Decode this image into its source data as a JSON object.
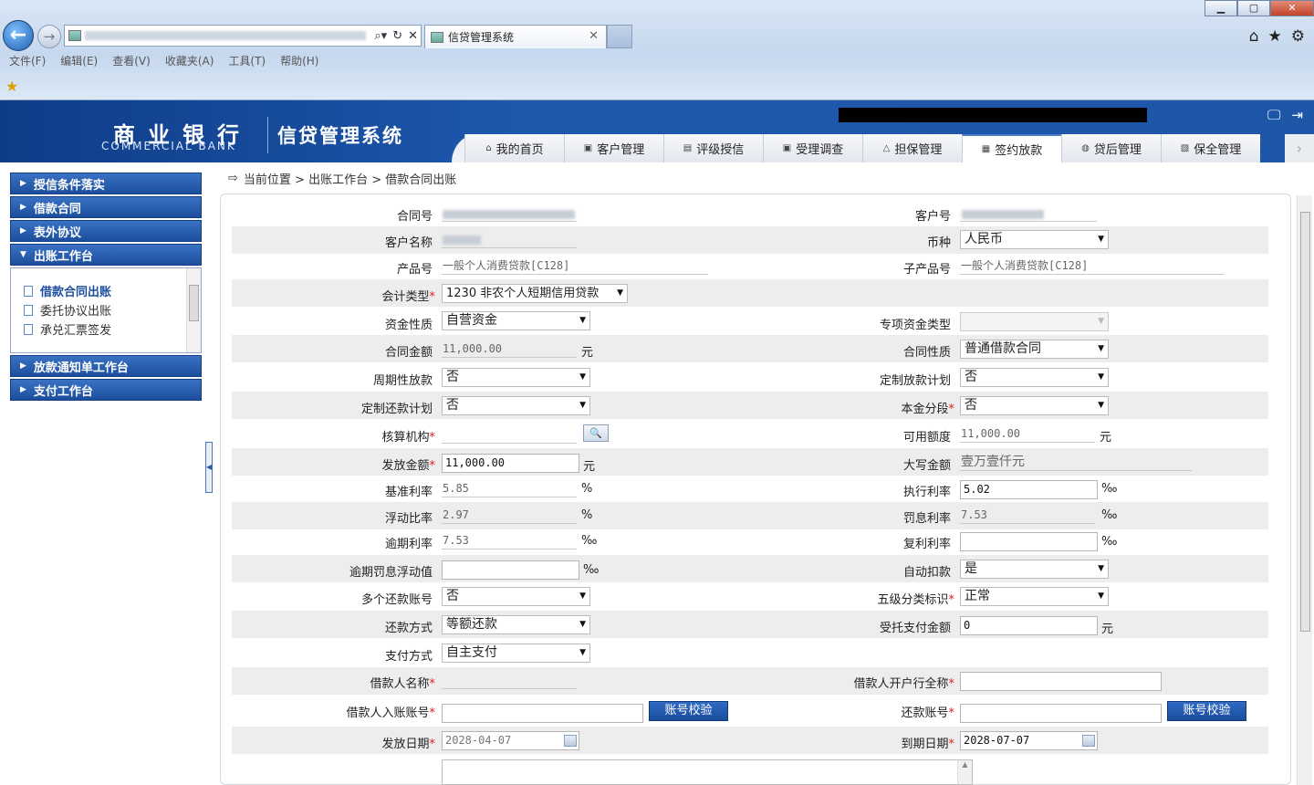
{
  "browser": {
    "tab_title": "信贷管理系统",
    "menu": [
      "文件(F)",
      "编辑(E)",
      "查看(V)",
      "收藏夹(A)",
      "工具(T)",
      "帮助(H)"
    ],
    "window_controls": [
      "▁",
      "▢",
      "✕"
    ]
  },
  "app": {
    "bank_cn": "商业银行",
    "bank_en": "COMMERCIAL BANK",
    "system_name": "信贷管理系统",
    "nav_tabs": [
      {
        "label": "我的首页",
        "icon": "home-icon"
      },
      {
        "label": "客户管理",
        "icon": "customer-icon"
      },
      {
        "label": "评级授信",
        "icon": "rating-icon"
      },
      {
        "label": "受理调查",
        "icon": "survey-icon"
      },
      {
        "label": "担保管理",
        "icon": "guarantee-icon"
      },
      {
        "label": "签约放款",
        "icon": "contract-icon",
        "active": true
      },
      {
        "label": "贷后管理",
        "icon": "postloan-icon"
      },
      {
        "label": "保全管理",
        "icon": "preservation-icon"
      }
    ]
  },
  "sidebar": {
    "sections": [
      "授信条件落实",
      "借款合同",
      "表外协议",
      "出账工作台",
      "放款通知单工作台",
      "支付工作台"
    ],
    "expanded_index": 3,
    "items": [
      "借款合同出账",
      "委托协议出账",
      "承兑汇票签发"
    ],
    "active_item": 0
  },
  "breadcrumb": {
    "text": "当前位置 > 出账工作台 > 借款合同出账"
  },
  "form": {
    "contract_no_label": "合同号",
    "customer_no_label": "客户号",
    "customer_name_label": "客户名称",
    "currency_label": "币种",
    "currency_value": "人民币",
    "product_no_label": "产品号",
    "product_no_value": "一般个人消费贷款[C128]",
    "sub_product_label": "子产品号",
    "sub_product_value": "一般个人消费贷款[C128]",
    "accounting_type_label": "会计类型",
    "accounting_type_value": "1230 非农个人短期信用贷款",
    "fund_nature_label": "资金性质",
    "fund_nature_value": "自营资金",
    "special_fund_label": "专项资金类型",
    "special_fund_value": "",
    "contract_amount_label": "合同金额",
    "contract_amount_value": "11,000.00",
    "contract_nature_label": "合同性质",
    "contract_nature_value": "普通借款合同",
    "periodic_release_label": "周期性放款",
    "periodic_release_value": "否",
    "custom_release_plan_label": "定制放款计划",
    "custom_release_plan_value": "否",
    "custom_repay_plan_label": "定制还款计划",
    "custom_repay_plan_value": "否",
    "principal_segment_label": "本金分段",
    "principal_segment_value": "否",
    "accounting_org_label": "核算机构",
    "available_amount_label": "可用额度",
    "available_amount_value": "11,000.00",
    "release_amount_label": "发放金额",
    "release_amount_value": "11,000.00",
    "amount_upper_label": "大写金额",
    "amount_upper_value": "壹万壹仟元",
    "base_rate_label": "基准利率",
    "base_rate_value": "5.85",
    "exec_rate_label": "执行利率",
    "exec_rate_value": "5.02",
    "float_ratio_label": "浮动比率",
    "float_ratio_value": "2.97",
    "penalty_rate_label": "罚息利率",
    "penalty_rate_value": "7.53",
    "overdue_rate_label": "逾期利率",
    "overdue_rate_value": "7.53",
    "compound_rate_label": "复利利率",
    "compound_rate_value": "",
    "overdue_penalty_float_label": "逾期罚息浮动值",
    "overdue_penalty_float_value": "",
    "auto_deduct_label": "自动扣款",
    "auto_deduct_value": "是",
    "multi_repay_acct_label": "多个还款账号",
    "multi_repay_acct_value": "否",
    "five_class_label": "五级分类标识",
    "five_class_value": "正常",
    "repay_method_label": "还款方式",
    "repay_method_value": "等额还款",
    "entrusted_pay_label": "受托支付金额",
    "entrusted_pay_value": "0",
    "pay_method_label": "支付方式",
    "pay_method_value": "自主支付",
    "borrower_name_label": "借款人名称",
    "borrower_bank_label": "借款人开户行全称",
    "borrower_bank_value": "",
    "borrower_acct_label": "借款人入账账号",
    "borrower_acct_value": "",
    "verify_btn_label": "账号校验",
    "repay_acct_label": "还款账号",
    "repay_acct_value": "",
    "release_date_label": "发放日期",
    "release_date_value": "2028-04-07",
    "due_date_label": "到期日期",
    "due_date_value": "2028-07-07",
    "unit_yuan": "元",
    "unit_percent": "%",
    "unit_permille": "‰"
  }
}
